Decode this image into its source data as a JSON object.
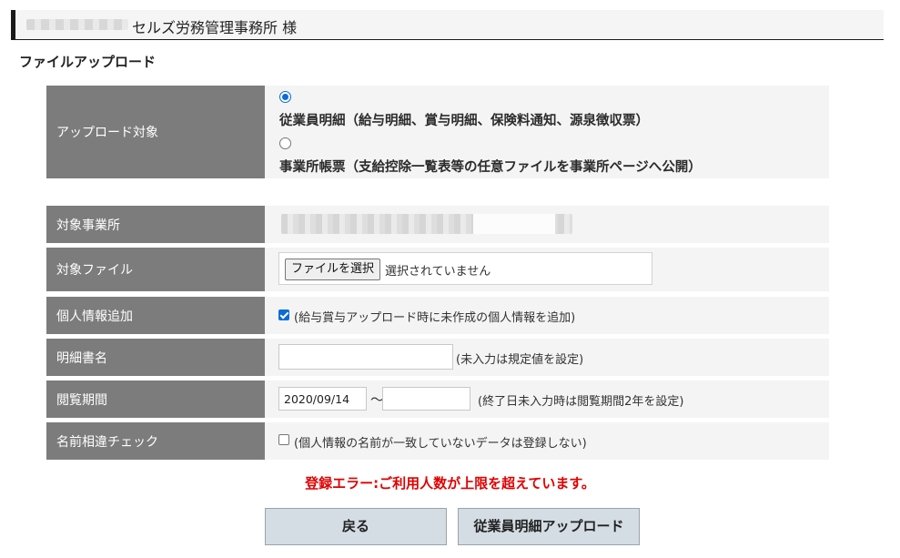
{
  "header": {
    "office_name": "セルズ労務管理事務所 様"
  },
  "page_title": "ファイルアップロード",
  "form": {
    "upload_target": {
      "label": "アップロード対象",
      "options": [
        {
          "label": "従業員明細（給与明細、賞与明細、保険料通知、源泉徴収票）",
          "selected": true
        },
        {
          "label": "事業所帳票（支給控除一覧表等の任意ファイルを事業所ページへ公開）",
          "selected": false
        }
      ]
    },
    "target_office": {
      "label": "対象事業所"
    },
    "target_file": {
      "label": "対象ファイル",
      "button_label": "ファイルを選択",
      "status": "選択されていません"
    },
    "add_personal_info": {
      "label": "個人情報追加",
      "checked": true,
      "note": "(給与賞与アップロード時に未作成の個人情報を追加)"
    },
    "statement_name": {
      "label": "明細書名",
      "value": "",
      "note": "(未入力は規定値を設定)"
    },
    "viewing_period": {
      "label": "閲覧期間",
      "start": "2020/09/14",
      "separator": "〜",
      "end": "",
      "note": "(終了日未入力時は閲覧期間2年を設定)"
    },
    "name_mismatch_check": {
      "label": "名前相違チェック",
      "checked": false,
      "note": "(個人情報の名前が一致していないデータは登録しない)"
    }
  },
  "error_message": "登録エラー:ご利用人数が上限を超えています。",
  "buttons": {
    "back": "戻る",
    "upload": "従業員明細アップロード"
  },
  "colors": {
    "label_bg": "#7c7c7c",
    "cell_bg": "#f4f4f4",
    "button_bg": "#d4dde4",
    "error": "#e00000",
    "accent": "#0a6cd6"
  }
}
